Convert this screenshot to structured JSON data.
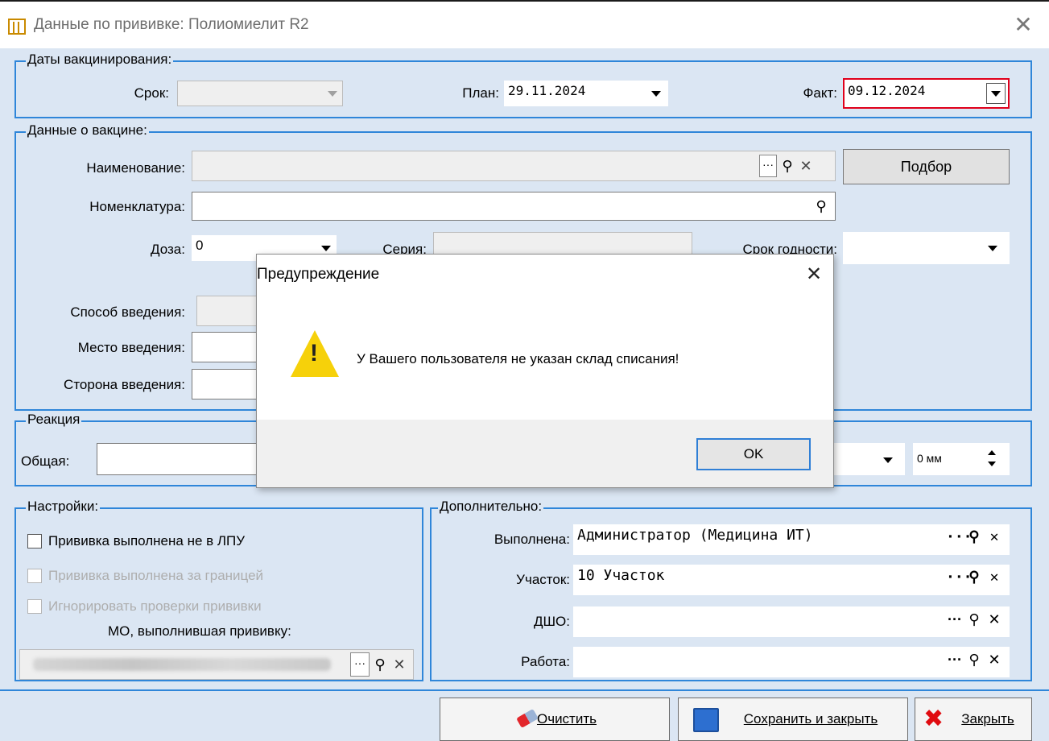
{
  "window": {
    "title": "Данные по прививке: Полиомиелит R2",
    "close_glyph": "✕"
  },
  "dates": {
    "legend": "Даты вакцинирования:",
    "term_label": "Срок:",
    "term_value": "",
    "plan_label": "План:",
    "plan_value": "29.11.2024",
    "fact_label": "Факт:",
    "fact_value": "09.12.2024"
  },
  "vaccine": {
    "legend": "Данные о вакцине:",
    "name_label": "Наименование:",
    "name_value": "",
    "select_button": "Подбор",
    "nomenclature_label": "Номенклатура:",
    "nomenclature_value": "",
    "dose_label": "Доза:",
    "dose_value": "0",
    "series_label": "Серия:",
    "series_value": "",
    "expiry_label": "Срок годности:",
    "expiry_value": "",
    "method_label": "Способ введения:",
    "place_label": "Место введения:",
    "side_label": "Сторона введения:"
  },
  "reaction": {
    "legend": "Реакция",
    "general_label": "Общая:",
    "mm_value": "0 мм"
  },
  "settings": {
    "legend": "Настройки:",
    "cb_not_in_lpu": "Прививка выполнена не в ЛПУ",
    "cb_abroad": "Прививка выполнена за границей",
    "cb_ignore": "Игнорировать проверки прививки",
    "mo_label": "МО, выполнившая прививку:"
  },
  "extra": {
    "legend": "Дополнительно:",
    "done_by_label": "Выполнена:",
    "done_by_value": "Администратор (Медицина ИТ)",
    "district_label": "Участок:",
    "district_value": "10 Участок",
    "dsho_label": "ДШО:",
    "dsho_value": "",
    "work_label": "Работа:",
    "work_value": ""
  },
  "footer": {
    "clear": "Очистить",
    "save_close": "Сохранить и закрыть",
    "close": "Закрыть"
  },
  "dialog": {
    "title": "Предупреждение",
    "message": "У Вашего пользователя не указан склад списания!",
    "ok": "OK"
  },
  "colors": {
    "group_border": "#2f86d9",
    "window_bg": "#dbe6f3",
    "fact_border": "#e0001b"
  }
}
